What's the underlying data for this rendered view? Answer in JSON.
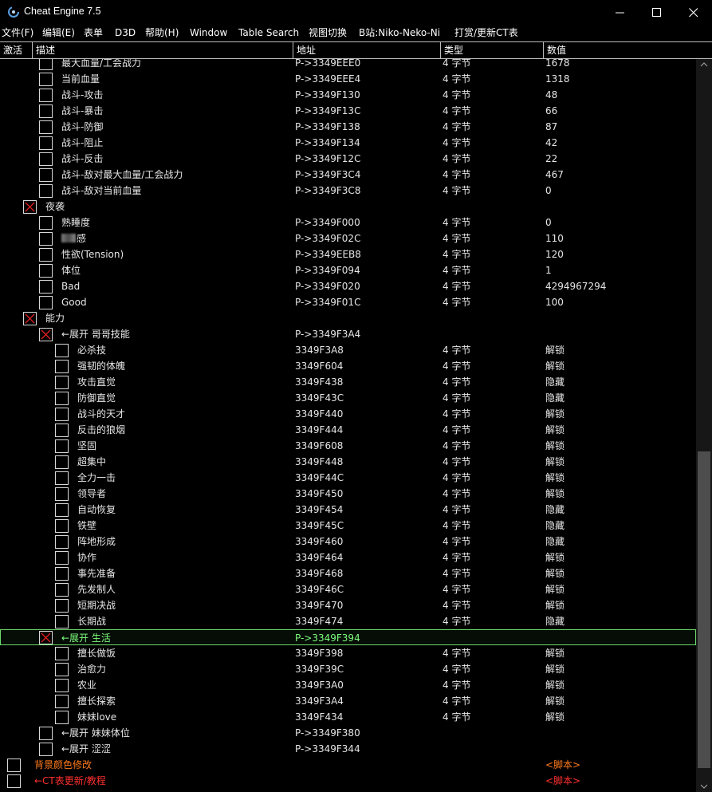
{
  "window": {
    "title": "Cheat Engine 7.5"
  },
  "menu": [
    "文件(F)",
    "编辑(E)",
    "表单",
    "D3D",
    "帮助(H)",
    "Window",
    "Table Search",
    "视图切换",
    "B站:Niko-Neko-Ni",
    "打赏/更新CT表"
  ],
  "columns": {
    "active": "激活",
    "description": "描述",
    "address": "地址",
    "type": "类型",
    "value": "数值"
  },
  "rows": [
    {
      "level": 2,
      "desc": "最大血量/工会战力",
      "addr": "P->3349EEE0",
      "type": "4 字节",
      "val": "1678"
    },
    {
      "level": 2,
      "desc": "当前血量",
      "addr": "P->3349EEE4",
      "type": "4 字节",
      "val": "1318"
    },
    {
      "level": 2,
      "desc": "战斗-攻击",
      "addr": "P->3349F130",
      "type": "4 字节",
      "val": "48"
    },
    {
      "level": 2,
      "desc": "战斗-暴击",
      "addr": "P->3349F13C",
      "type": "4 字节",
      "val": "66"
    },
    {
      "level": 2,
      "desc": "战斗-防御",
      "addr": "P->3349F138",
      "type": "4 字节",
      "val": "87"
    },
    {
      "level": 2,
      "desc": "战斗-阻止",
      "addr": "P->3349F134",
      "type": "4 字节",
      "val": "42"
    },
    {
      "level": 2,
      "desc": "战斗-反击",
      "addr": "P->3349F12C",
      "type": "4 字节",
      "val": "22"
    },
    {
      "level": 2,
      "desc": "战斗-敌对最大血量/工会战力",
      "addr": "P->3349F3C4",
      "type": "4 字节",
      "val": "467"
    },
    {
      "level": 2,
      "desc": "战斗-敌对当前血量",
      "addr": "P->3349F3C8",
      "type": "4 字节",
      "val": "0"
    },
    {
      "level": 1,
      "checked": true,
      "desc": "夜袭",
      "addr": "",
      "type": "",
      "val": ""
    },
    {
      "level": 2,
      "desc": "熟睡度",
      "addr": "P->3349F000",
      "type": "4 字节",
      "val": "0"
    },
    {
      "level": 2,
      "desc": "感",
      "blurred": true,
      "addr": "P->3349F02C",
      "type": "4 字节",
      "val": "110"
    },
    {
      "level": 2,
      "desc": "性欲(Tension)",
      "addr": "P->3349EEB8",
      "type": "4 字节",
      "val": "120"
    },
    {
      "level": 2,
      "desc": "体位",
      "addr": "P->3349F094",
      "type": "4 字节",
      "val": "1"
    },
    {
      "level": 2,
      "desc": "Bad",
      "addr": "P->3349F020",
      "type": "4 字节",
      "val": "4294967294"
    },
    {
      "level": 2,
      "desc": "Good",
      "addr": "P->3349F01C",
      "type": "4 字节",
      "val": "100"
    },
    {
      "level": 1,
      "checked": true,
      "desc": "能力",
      "addr": "",
      "type": "",
      "val": ""
    },
    {
      "level": 2,
      "checked": true,
      "desc": "←展开 哥哥技能",
      "addr": "P->3349F3A4",
      "type": "",
      "val": ""
    },
    {
      "level": 3,
      "desc": "必杀技",
      "addr": "3349F3A8",
      "type": "4 字节",
      "val": "解锁"
    },
    {
      "level": 3,
      "desc": "强韧的体魄",
      "addr": "3349F604",
      "type": "4 字节",
      "val": "解锁"
    },
    {
      "level": 3,
      "desc": "攻击直觉",
      "addr": "3349F438",
      "type": "4 字节",
      "val": "隐藏"
    },
    {
      "level": 3,
      "desc": "防御直觉",
      "addr": "3349F43C",
      "type": "4 字节",
      "val": "隐藏"
    },
    {
      "level": 3,
      "desc": "战斗的天才",
      "addr": "3349F440",
      "type": "4 字节",
      "val": "解锁"
    },
    {
      "level": 3,
      "desc": "反击的狼烟",
      "addr": "3349F444",
      "type": "4 字节",
      "val": "解锁"
    },
    {
      "level": 3,
      "desc": "坚固",
      "addr": "3349F608",
      "type": "4 字节",
      "val": "解锁"
    },
    {
      "level": 3,
      "desc": "超集中",
      "addr": "3349F448",
      "type": "4 字节",
      "val": "解锁"
    },
    {
      "level": 3,
      "desc": "全力一击",
      "addr": "3349F44C",
      "type": "4 字节",
      "val": "解锁"
    },
    {
      "level": 3,
      "desc": "领导者",
      "addr": "3349F450",
      "type": "4 字节",
      "val": "解锁"
    },
    {
      "level": 3,
      "desc": "自动恢复",
      "addr": "3349F454",
      "type": "4 字节",
      "val": "隐藏"
    },
    {
      "level": 3,
      "desc": "铁壁",
      "addr": "3349F45C",
      "type": "4 字节",
      "val": "隐藏"
    },
    {
      "level": 3,
      "desc": "阵地形成",
      "addr": "3349F460",
      "type": "4 字节",
      "val": "隐藏"
    },
    {
      "level": 3,
      "desc": "协作",
      "addr": "3349F464",
      "type": "4 字节",
      "val": "解锁"
    },
    {
      "level": 3,
      "desc": "事先准备",
      "addr": "3349F468",
      "type": "4 字节",
      "val": "解锁"
    },
    {
      "level": 3,
      "desc": "先发制人",
      "addr": "3349F46C",
      "type": "4 字节",
      "val": "解锁"
    },
    {
      "level": 3,
      "desc": "短期决战",
      "addr": "3349F470",
      "type": "4 字节",
      "val": "解锁"
    },
    {
      "level": 3,
      "desc": "长期战",
      "addr": "3349F474",
      "type": "4 字节",
      "val": "隐藏"
    },
    {
      "level": 2,
      "checked": true,
      "selected": true,
      "desc": "←展开 生活",
      "addr": "P->3349F394",
      "type": "",
      "val": ""
    },
    {
      "level": 3,
      "desc": "擅长做饭",
      "addr": "3349F398",
      "type": "4 字节",
      "val": "解锁"
    },
    {
      "level": 3,
      "desc": "治愈力",
      "addr": "3349F39C",
      "type": "4 字节",
      "val": "解锁"
    },
    {
      "level": 3,
      "desc": "农业",
      "addr": "3349F3A0",
      "type": "4 字节",
      "val": "解锁"
    },
    {
      "level": 3,
      "desc": "擅长探索",
      "addr": "3349F3A4",
      "type": "4 字节",
      "val": "解锁"
    },
    {
      "level": 3,
      "desc": "妹妹love",
      "addr": "3349F434",
      "type": "4 字节",
      "val": "解锁"
    },
    {
      "level": 2,
      "desc": "←展开 妹妹体位",
      "addr": "P->3349F380",
      "type": "",
      "val": ""
    },
    {
      "level": 2,
      "desc": "←展开 涩涩",
      "addr": "P->3349F344",
      "type": "",
      "val": ""
    },
    {
      "level": 0,
      "style": "orange",
      "desc": "背景颜色修改",
      "addr": "",
      "type": "",
      "val": "<脚本>"
    },
    {
      "level": 0,
      "style": "red",
      "desc": "←CT表更新/教程",
      "addr": "",
      "type": "",
      "val": "<脚本>"
    }
  ],
  "colors": {
    "selection": "#6edc6e",
    "orange": "#ff7a1a",
    "red": "#ff3030",
    "checkmark": "#e02020"
  }
}
